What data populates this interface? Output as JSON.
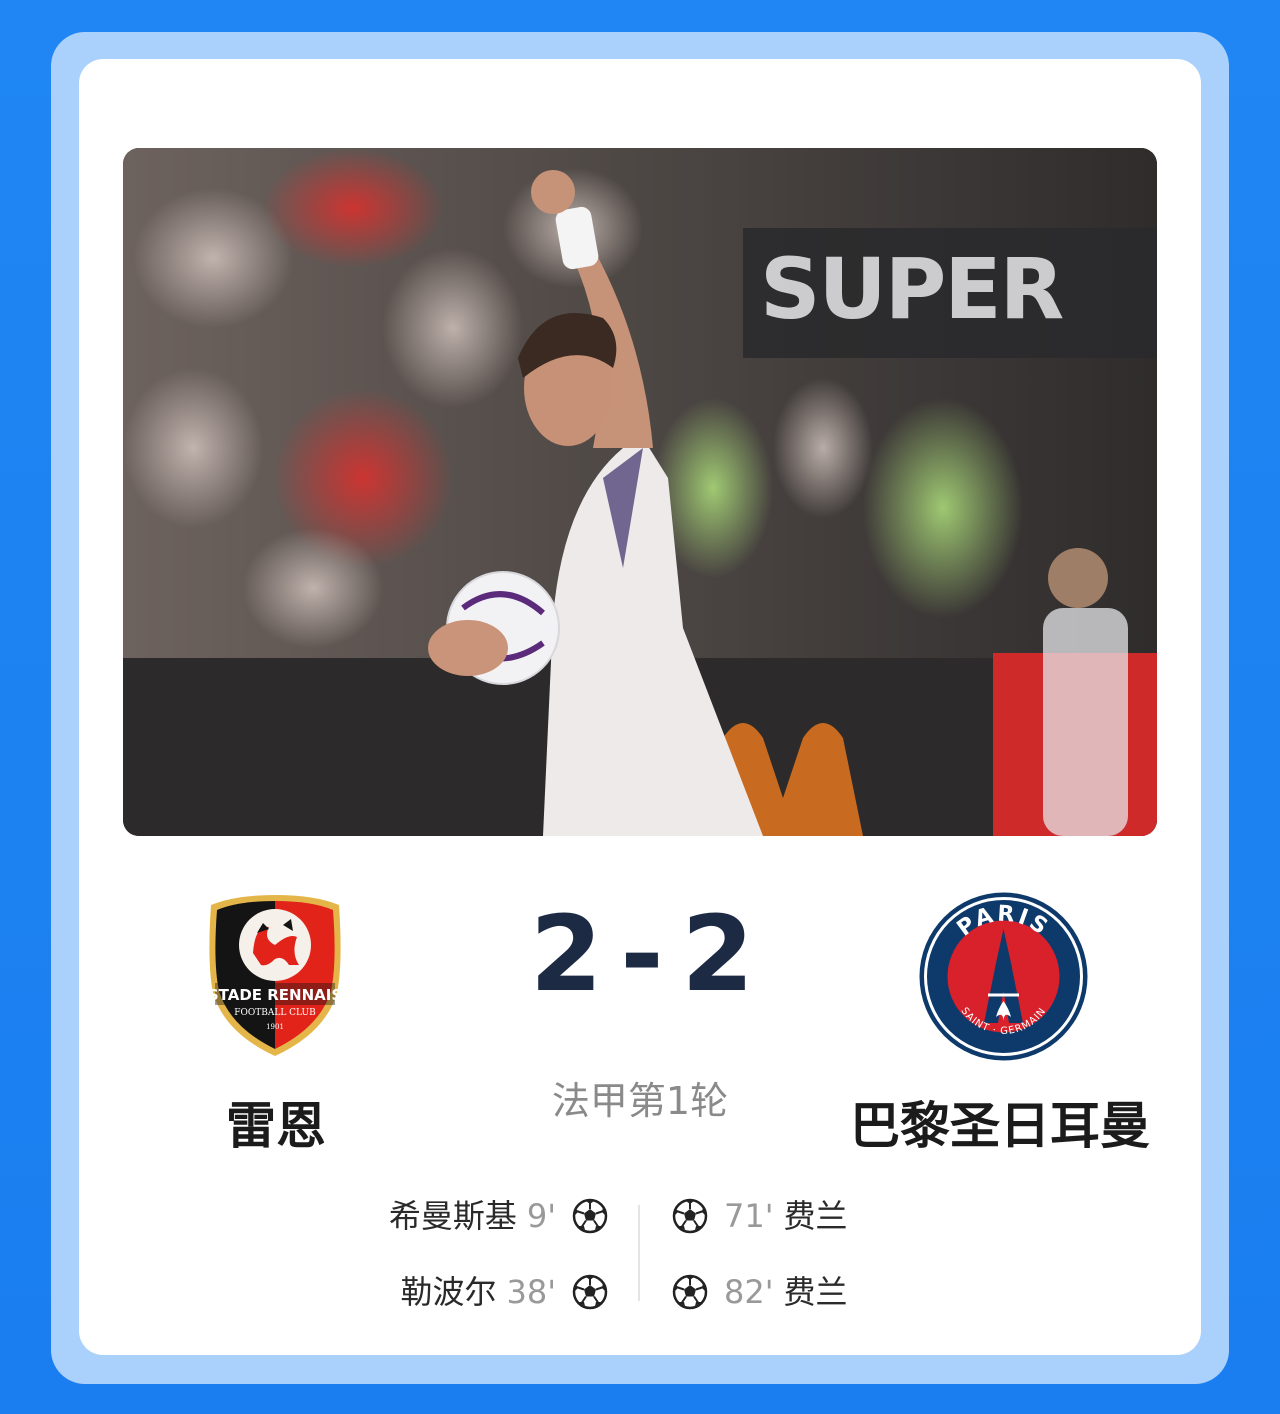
{
  "photo": {
    "sign_text": "SUPER"
  },
  "match": {
    "home": {
      "name": "雷恩",
      "crest_text": "STADE RENNAIS",
      "crest_sub": "FOOTBALL CLUB",
      "crest_year": "1901",
      "score": "2",
      "goals": [
        {
          "player": "希曼斯基",
          "minute": "9'"
        },
        {
          "player": "勒波尔",
          "minute": "38'"
        }
      ]
    },
    "away": {
      "name": "巴黎圣日耳曼",
      "crest_text": "PARIS",
      "crest_sub": "SAINT · GERMAIN",
      "score": "2",
      "goals": [
        {
          "player": "费兰",
          "minute": "71'"
        },
        {
          "player": "费兰",
          "minute": "82'"
        }
      ]
    },
    "separator": "-",
    "round": "法甲第1轮"
  },
  "icons": {
    "goal": "soccer-ball-icon"
  },
  "colors": {
    "background": "#1f86f3",
    "frame": "#a9d1fb",
    "score_text": "#1d2a44",
    "rennes_red": "#e2231a",
    "psg_navy": "#0d3a6b",
    "psg_red": "#d8212b"
  }
}
